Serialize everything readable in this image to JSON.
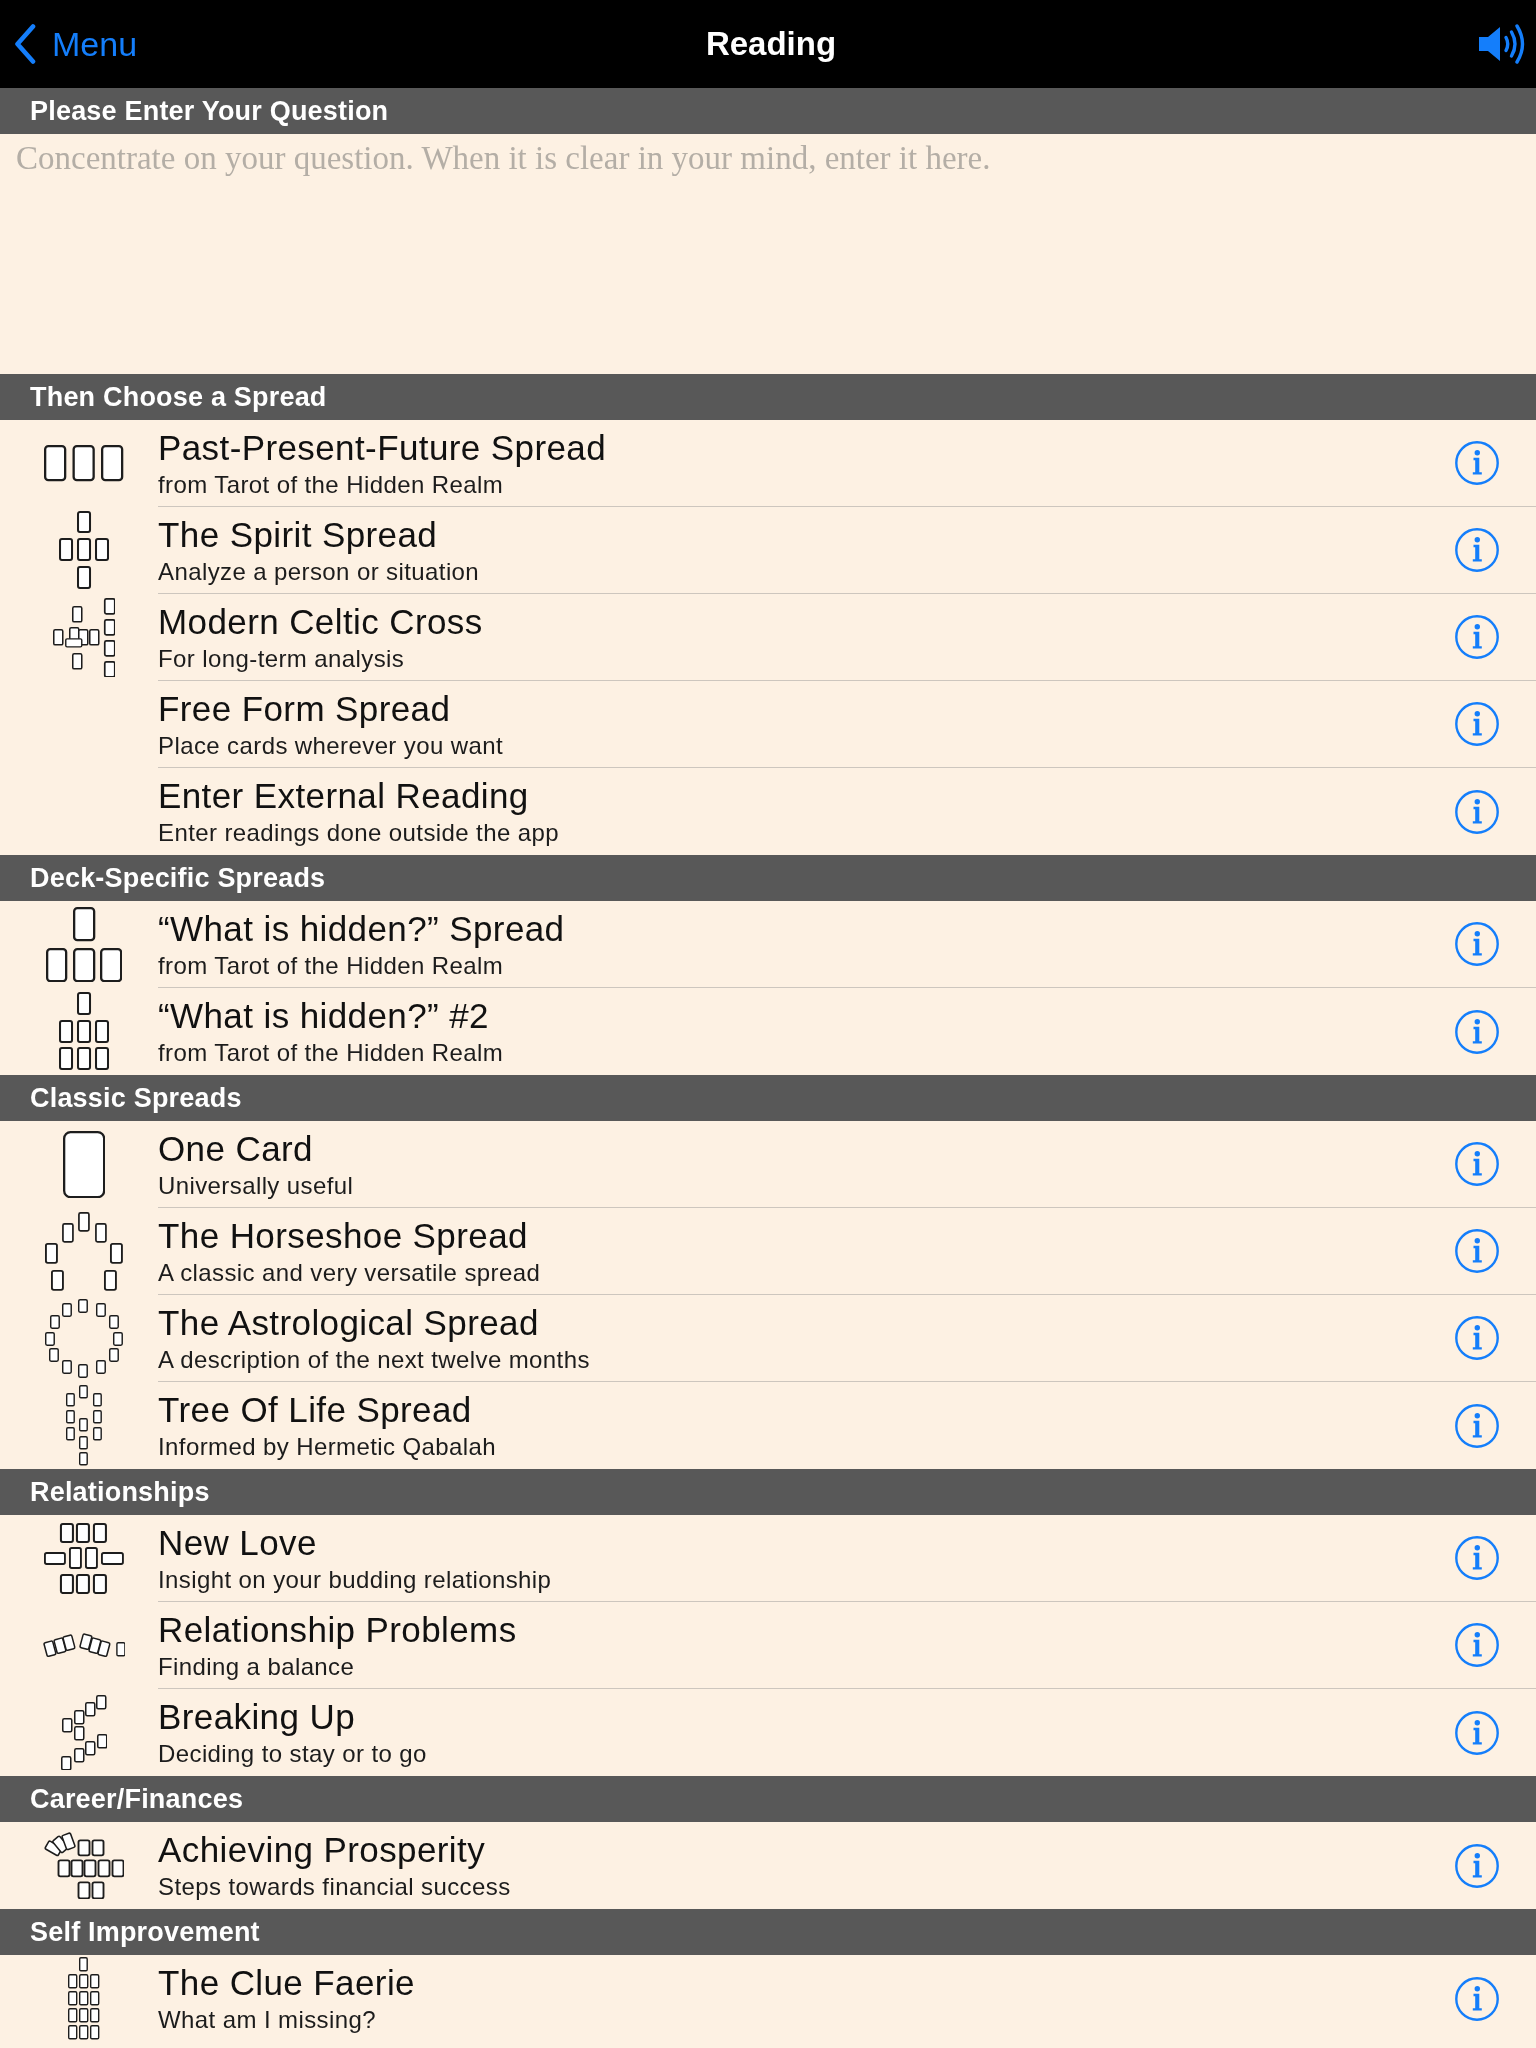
{
  "nav": {
    "back_label": "Menu",
    "title": "Reading"
  },
  "question": {
    "header": "Please Enter Your Question",
    "placeholder": "Concentrate on your question. When it is clear in your mind, enter it here."
  },
  "sections": [
    {
      "title": "Then Choose a Spread",
      "rows": [
        {
          "title": "Past-Present-Future Spread",
          "subtitle": "from Tarot of the Hidden Realm"
        },
        {
          "title": "The Spirit Spread",
          "subtitle": "Analyze a person or situation"
        },
        {
          "title": "Modern Celtic Cross",
          "subtitle": "For long-term analysis"
        },
        {
          "title": "Free Form Spread",
          "subtitle": "Place cards wherever you want"
        },
        {
          "title": "Enter External Reading",
          "subtitle": "Enter readings done outside the app"
        }
      ]
    },
    {
      "title": "Deck-Specific Spreads",
      "rows": [
        {
          "title": "“What is hidden?” Spread",
          "subtitle": "from Tarot of the Hidden Realm"
        },
        {
          "title": "“What is hidden?” #2",
          "subtitle": "from Tarot of the Hidden Realm"
        }
      ]
    },
    {
      "title": "Classic Spreads",
      "rows": [
        {
          "title": "One Card",
          "subtitle": "Universally useful"
        },
        {
          "title": "The Horseshoe Spread",
          "subtitle": "A classic and very versatile spread"
        },
        {
          "title": "The Astrological Spread",
          "subtitle": "A description of the next twelve months"
        },
        {
          "title": "Tree Of Life Spread",
          "subtitle": "Informed by Hermetic Qabalah"
        }
      ]
    },
    {
      "title": "Relationships",
      "rows": [
        {
          "title": "New Love",
          "subtitle": "Insight on your budding relationship"
        },
        {
          "title": "Relationship Problems",
          "subtitle": "Finding a balance"
        },
        {
          "title": "Breaking Up",
          "subtitle": "Deciding to stay or to go"
        }
      ]
    },
    {
      "title": "Career/Finances",
      "rows": [
        {
          "title": "Achieving Prosperity",
          "subtitle": "Steps towards financial success"
        }
      ]
    },
    {
      "title": "Self Improvement",
      "rows": [
        {
          "title": "The Clue Faerie",
          "subtitle": "What am I missing?"
        }
      ]
    }
  ]
}
